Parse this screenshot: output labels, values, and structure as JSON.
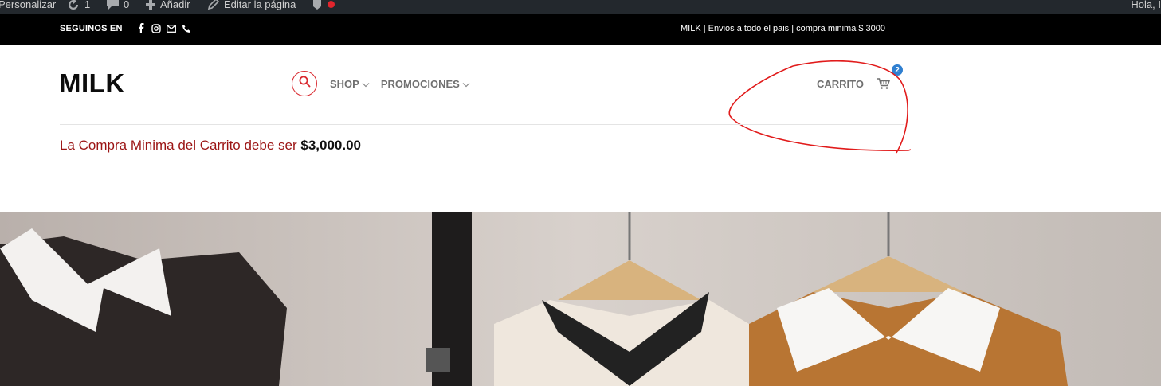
{
  "admin_bar": {
    "customize_label": "Personalizar",
    "updates_count": "1",
    "comments_count": "0",
    "new_label": "Añadir",
    "edit_label": "Editar la página",
    "user_greeting": "Hola, I"
  },
  "top_bar": {
    "follow_label": "SEGUINOS EN",
    "social_icons": [
      "facebook-icon",
      "instagram-icon",
      "envelope-icon",
      "phone-icon"
    ],
    "promo_text": "MILK | Envios a todo el pais | compra minima $ 3000"
  },
  "header": {
    "logo_text": "MILK",
    "nav": [
      {
        "label": "SHOP"
      },
      {
        "label": "PROMOCIONES"
      }
    ],
    "cart_label": "CARRITO",
    "cart_count": "2"
  },
  "notice": {
    "text": "La Compra Minima del Carrito debe ser",
    "amount": "$3,000.00"
  },
  "colors": {
    "accent_red": "#d9292f",
    "badge_blue": "#2f7fd0",
    "notice_red": "#9b1414",
    "topbar_bg": "#000000",
    "adminbar_bg": "#23282d"
  }
}
